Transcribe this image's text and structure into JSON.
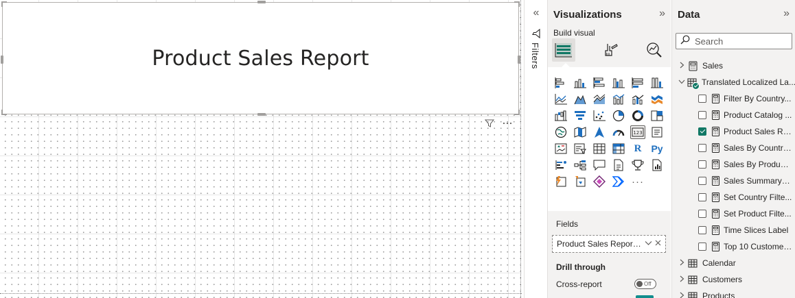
{
  "canvas": {
    "title": "Product Sales Report"
  },
  "filters": {
    "label": "Filters",
    "collapse_glyph": "«"
  },
  "visualizations": {
    "title": "Visualizations",
    "expand_glyph": "»",
    "build_label": "Build visual",
    "more_glyph": "···",
    "fields_label": "Fields",
    "field_value": "Product Sales Report ...",
    "drill_label": "Drill through",
    "cross_report_label": "Cross-report",
    "toggle_text": "Off",
    "r_label": "R",
    "py_label": "Py"
  },
  "data": {
    "title": "Data",
    "expand_glyph": "»",
    "search_placeholder": "Search",
    "tables": [
      {
        "name": "Sales"
      },
      {
        "name": "Translated Localized La..."
      },
      {
        "name": "Calendar"
      },
      {
        "name": "Customers"
      },
      {
        "name": "Products"
      }
    ],
    "measures": [
      {
        "name": "Filter By Country...",
        "checked": false
      },
      {
        "name": "Product Catalog ...",
        "checked": false
      },
      {
        "name": "Product Sales Re...",
        "checked": true
      },
      {
        "name": "Sales By Country...",
        "checked": false
      },
      {
        "name": "Sales By Product...",
        "checked": false
      },
      {
        "name": "Sales Summary L...",
        "checked": false
      },
      {
        "name": "Set Country Filte...",
        "checked": false
      },
      {
        "name": "Set Product Filte...",
        "checked": false
      },
      {
        "name": "Time Slices Label",
        "checked": false
      },
      {
        "name": "Top 10 Customer...",
        "checked": false
      }
    ]
  },
  "colors": {
    "accent_teal": "#117865",
    "pane_bg": "#f3f2f1",
    "viz_blue": "#1e6fbf"
  }
}
